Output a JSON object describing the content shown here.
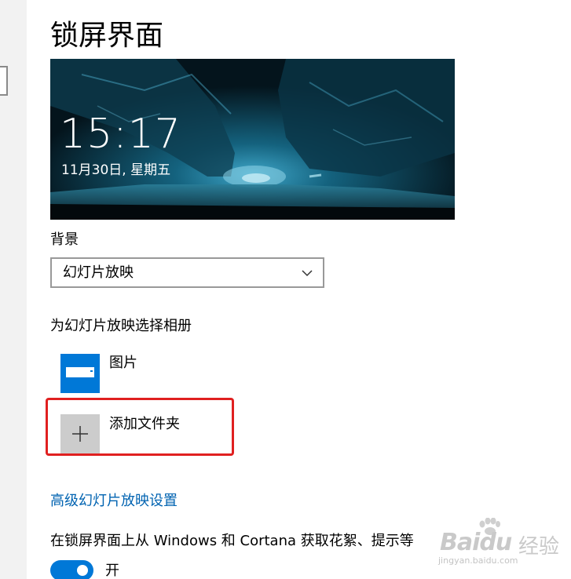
{
  "page": {
    "title": "锁屏界面"
  },
  "preview": {
    "time": "15:17",
    "date": "11月30日, 星期五"
  },
  "background": {
    "label": "背景",
    "selected_value": "幻灯片放映"
  },
  "albums": {
    "heading": "为幻灯片放映选择相册",
    "items": [
      {
        "label": "图片",
        "icon": "pictures-folder-icon",
        "color": "#0078d7"
      },
      {
        "label": "添加文件夹",
        "icon": "plus-icon",
        "color": "#cccccc"
      }
    ]
  },
  "advanced_link": {
    "label": "高级幻灯片放映设置"
  },
  "tips": {
    "label": "在锁屏界面上从 Windows 和 Cortana 获取花絮、提示等",
    "toggle_state": "开",
    "toggle_on": true
  },
  "watermark": {
    "brand": "Baidu",
    "brand_suffix": "经验",
    "url": "jingyan.baidu.com"
  },
  "colors": {
    "accent": "#0078d7",
    "link": "#0063b1",
    "annotation_border": "#e02020"
  }
}
